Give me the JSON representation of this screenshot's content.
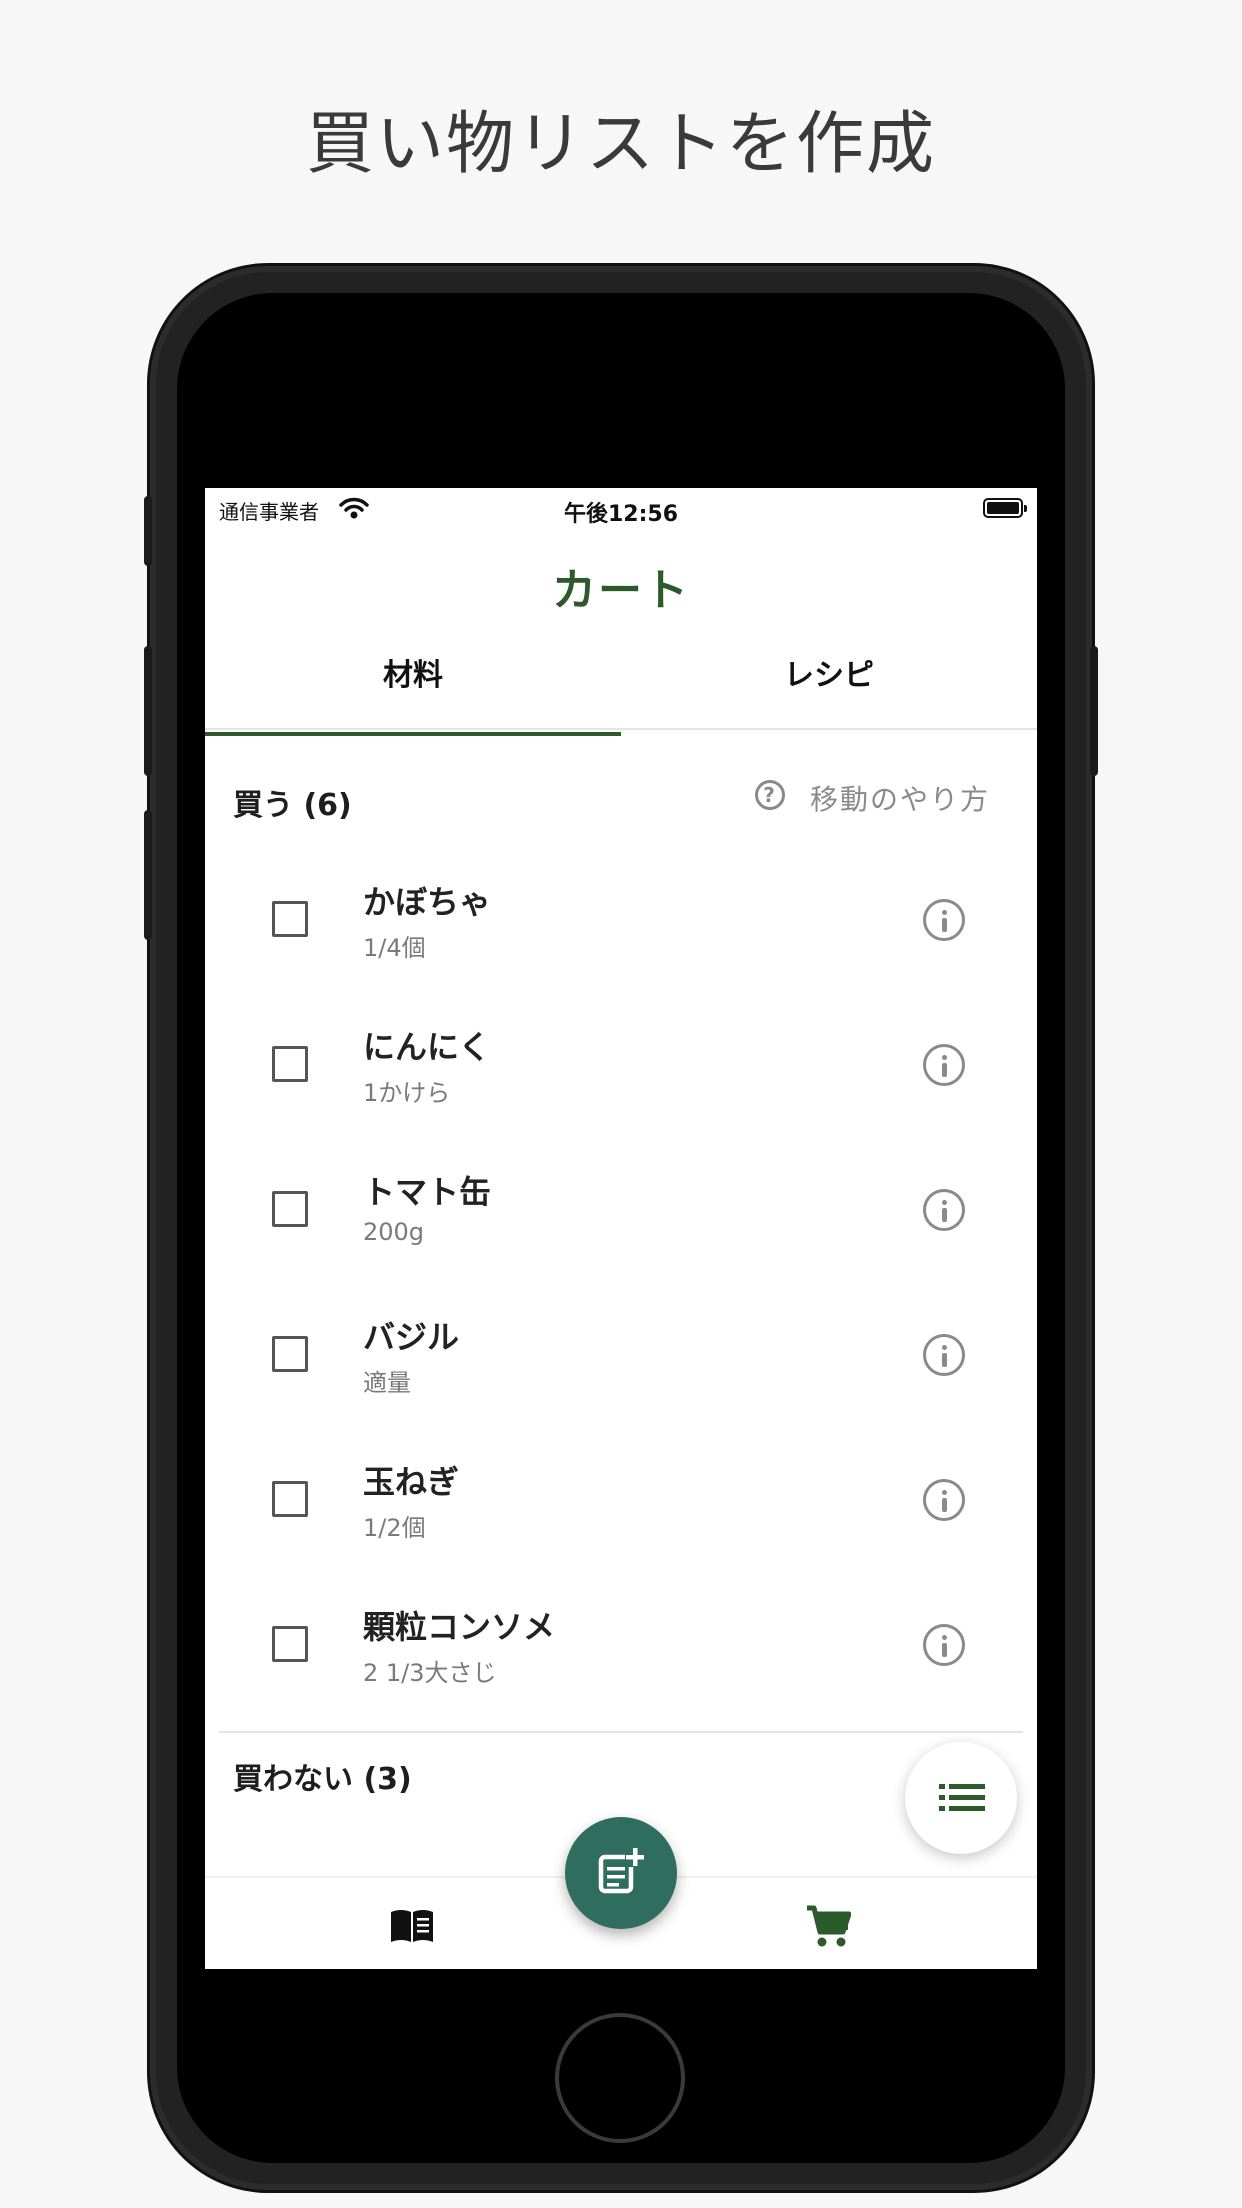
{
  "promo": {
    "title": "買い物リストを作成"
  },
  "status_bar": {
    "carrier": "通信事業者",
    "time": "午後12:56"
  },
  "nav": {
    "title": "カート"
  },
  "tabs": [
    {
      "label": "材料",
      "selected": true
    },
    {
      "label": "レシピ",
      "selected": false
    }
  ],
  "buy_section": {
    "header": "買う (6)",
    "help_label": "移動のやり方",
    "help_icon": "question-circle-icon",
    "items": [
      {
        "name": "かぼちゃ",
        "quantity": "1/4個",
        "checked": false
      },
      {
        "name": "にんにく",
        "quantity": "1かけら",
        "checked": false
      },
      {
        "name": "トマト缶",
        "quantity": "200g",
        "checked": false
      },
      {
        "name": "バジル",
        "quantity": "適量",
        "checked": false
      },
      {
        "name": "玉ねぎ",
        "quantity": "1/2個",
        "checked": false
      },
      {
        "name": "顆粒コンソメ",
        "quantity": "2 1/3大さじ",
        "checked": false
      }
    ]
  },
  "skip_section": {
    "header": "買わない (3)"
  },
  "fab": {
    "list_icon": "list-icon",
    "add_icon": "add-note-icon"
  },
  "bottom_nav": [
    {
      "icon": "book-icon",
      "active": false
    },
    {
      "icon": "cart-icon",
      "active": true
    }
  ],
  "colors": {
    "accent": "#2d5a2a",
    "fab": "#2f6d5e",
    "muted": "#8a8a8a"
  }
}
